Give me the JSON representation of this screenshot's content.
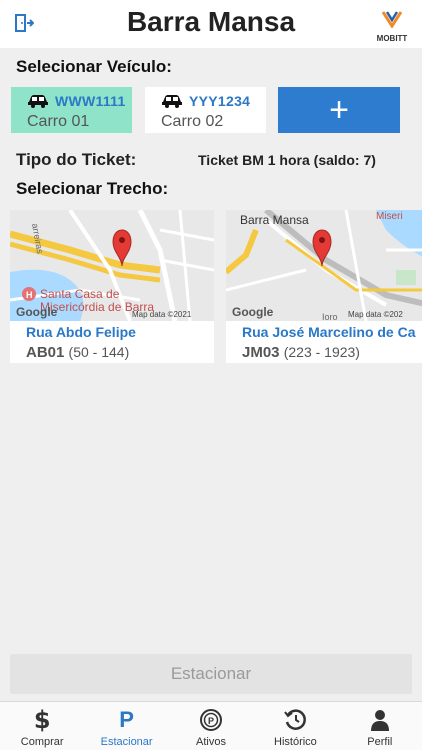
{
  "header": {
    "title": "Barra Mansa",
    "logout_icon": "logout-door-icon",
    "brand": {
      "name": "MOBITT",
      "logo_letter": "M",
      "colors": [
        "#f08a24",
        "#2d5fa8"
      ]
    }
  },
  "vehicle_section": {
    "title": "Selecionar Veículo:",
    "vehicles": [
      {
        "plate": "WWW1111",
        "name": "Carro 01",
        "selected": true
      },
      {
        "plate": "YYY1234",
        "name": "Carro 02",
        "selected": false
      }
    ],
    "add_label": "+"
  },
  "ticket": {
    "label": "Tipo do Ticket:",
    "value": "Ticket BM 1 hora (saldo: 7)"
  },
  "stretch_section": {
    "title": "Selecionar Trecho:",
    "stretches": [
      {
        "street": "Rua Abdo Felipe",
        "code": "AB01",
        "range": "(50 - 144)",
        "map": {
          "provider": "Google",
          "credit": "Map data ©2021",
          "labels": [
            "Santa Casa de",
            "Misericórdia de Barra",
            "arreiras"
          ]
        }
      },
      {
        "street": "Rua José Marcelino de Ca",
        "code": "JM03",
        "range": "(223 - 1923)",
        "map": {
          "provider": "Google",
          "credit": "Map data ©202",
          "labels": [
            "Barra Mansa",
            "Miseri",
            "Ioro"
          ]
        }
      }
    ]
  },
  "park_button": {
    "label": "Estacionar",
    "enabled": false
  },
  "bottom_nav": [
    {
      "label": "Comprar",
      "icon": "dollar-icon",
      "active": false
    },
    {
      "label": "Estacionar",
      "icon": "parking-p-icon",
      "active": true
    },
    {
      "label": "Ativos",
      "icon": "parking-circle-icon",
      "active": false
    },
    {
      "label": "Histórico",
      "icon": "history-icon",
      "active": false
    },
    {
      "label": "Perfil",
      "icon": "person-icon",
      "active": false
    }
  ],
  "colors": {
    "accent": "#2a78c6",
    "button_blue": "#2d7cd0",
    "selected_vehicle": "#8fe3c8",
    "map_pin": "#e53935",
    "map_road": "#f5c842",
    "map_water": "#aadaff"
  }
}
